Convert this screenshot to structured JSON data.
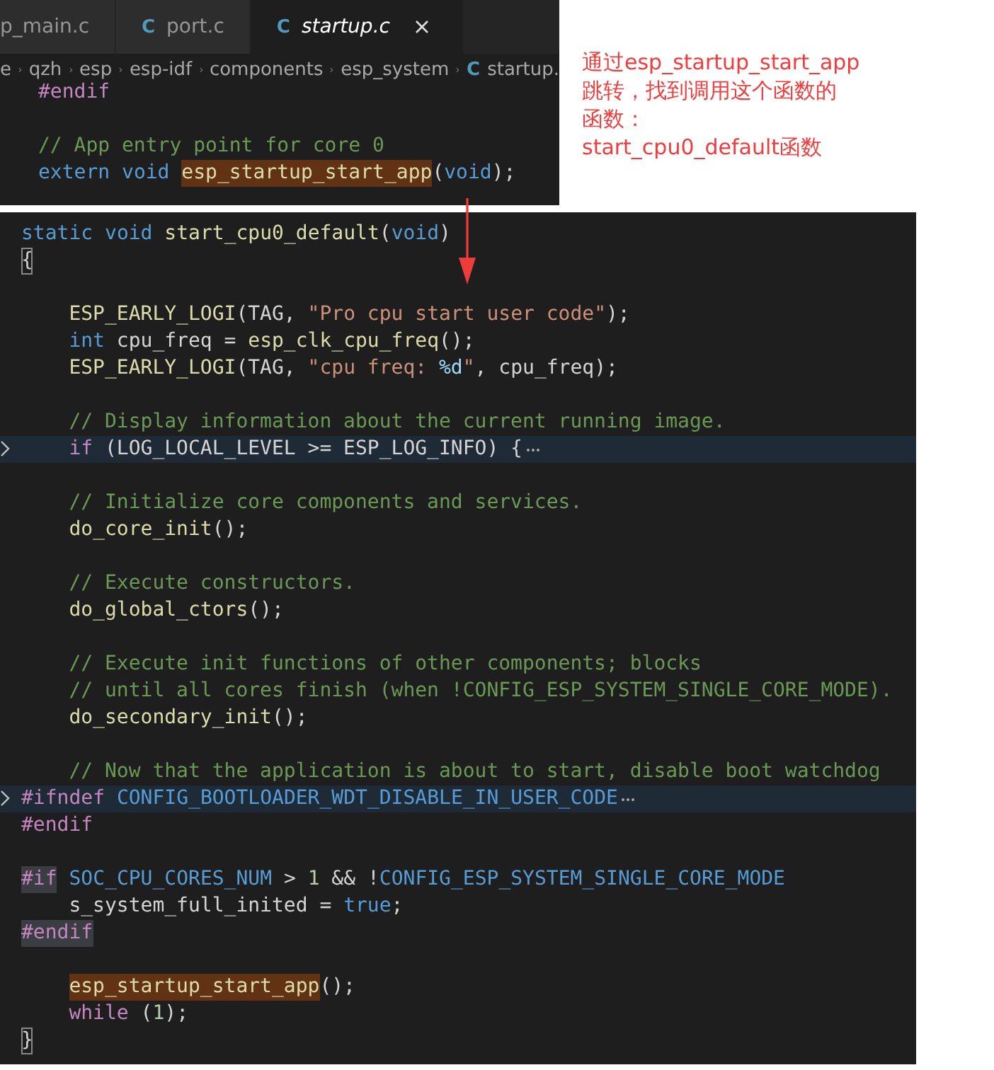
{
  "top_editor": {
    "tabs": [
      {
        "label": "p_main.c",
        "selected": false
      },
      {
        "icon": "C",
        "label": "port.c",
        "selected": false
      },
      {
        "icon": "C",
        "label": "startup.c",
        "selected": true
      }
    ],
    "breadcrumb": [
      {
        "label": "e"
      },
      {
        "label": "qzh"
      },
      {
        "label": "esp"
      },
      {
        "label": "esp-idf"
      },
      {
        "label": "components"
      },
      {
        "label": "esp_system"
      },
      {
        "icon": "C",
        "label": "startup."
      }
    ],
    "lines": [
      {
        "kind": "code",
        "tokens": [
          {
            "kind": "pp",
            "text": "#endif"
          }
        ]
      },
      {
        "kind": "blank"
      },
      {
        "kind": "code",
        "tokens": [
          {
            "kind": "cmt",
            "text": "// App entry point for core 0"
          }
        ]
      },
      {
        "kind": "code",
        "tokens": [
          {
            "kind": "kw",
            "text": "extern "
          },
          {
            "kind": "kw",
            "text": "void "
          },
          {
            "kind": "match",
            "text": "esp_startup_start_app"
          },
          {
            "kind": "txt",
            "text": "("
          },
          {
            "kind": "kw",
            "text": "void"
          },
          {
            "kind": "txt",
            "text": ");"
          }
        ]
      }
    ]
  },
  "annotation": [
    "通过esp_startup_start_app",
    "跳转，找到调用这个函数的",
    "函数：",
    "start_cpu0_default函数"
  ],
  "bottom_editor": {
    "lines": [
      {
        "folded": false,
        "indented": false,
        "tokens": [
          {
            "kind": "kw",
            "text": "static "
          },
          {
            "kind": "kw",
            "text": "void "
          },
          {
            "kind": "fn",
            "text": "start_cpu0_default"
          },
          {
            "kind": "txt",
            "text": "("
          },
          {
            "kind": "kw",
            "text": "void"
          },
          {
            "kind": "txt",
            "text": ")"
          }
        ]
      },
      {
        "folded": false,
        "indented": false,
        "tokens": [
          {
            "kind": "bracket",
            "text": "{"
          }
        ]
      },
      {
        "folded": false
      },
      {
        "folded": false,
        "indented": true,
        "tokens": [
          {
            "kind": "fn",
            "text": "ESP_EARLY_LOGI"
          },
          {
            "kind": "txt",
            "text": "(TAG, "
          },
          {
            "kind": "str",
            "text": "\"Pro cpu start user code\""
          },
          {
            "kind": "txt",
            "text": ");"
          }
        ]
      },
      {
        "folded": false,
        "indented": true,
        "tokens": [
          {
            "kind": "kw",
            "text": "int"
          },
          {
            "kind": "txt",
            "text": " cpu_freq = "
          },
          {
            "kind": "fn",
            "text": "esp_clk_cpu_freq"
          },
          {
            "kind": "txt",
            "text": "();"
          }
        ]
      },
      {
        "folded": false,
        "indented": true,
        "tokens": [
          {
            "kind": "fn",
            "text": "ESP_EARLY_LOGI"
          },
          {
            "kind": "txt",
            "text": "(TAG, "
          },
          {
            "kind": "str",
            "text": "\"cpu freq: "
          },
          {
            "kind": "esc",
            "text": "%d"
          },
          {
            "kind": "str",
            "text": "\""
          },
          {
            "kind": "txt",
            "text": ", cpu_freq);"
          }
        ]
      },
      {
        "folded": false
      },
      {
        "folded": false,
        "indented": true,
        "tokens": [
          {
            "kind": "cmt",
            "text": "// Display information about the current running image."
          }
        ]
      },
      {
        "folded": true,
        "indented": true,
        "tokens": [
          {
            "kind": "ctrl",
            "text": "if"
          },
          {
            "kind": "txt",
            "text": " (LOG_LOCAL_LEVEL >= ESP_LOG_INFO) {"
          }
        ]
      },
      {
        "folded": false
      },
      {
        "folded": false,
        "indented": true,
        "tokens": [
          {
            "kind": "cmt",
            "text": "// Initialize core components and services."
          }
        ]
      },
      {
        "folded": false,
        "indented": true,
        "tokens": [
          {
            "kind": "fn",
            "text": "do_core_init"
          },
          {
            "kind": "txt",
            "text": "();"
          }
        ]
      },
      {
        "folded": false
      },
      {
        "folded": false,
        "indented": true,
        "tokens": [
          {
            "kind": "cmt",
            "text": "// Execute constructors."
          }
        ]
      },
      {
        "folded": false,
        "indented": true,
        "tokens": [
          {
            "kind": "fn",
            "text": "do_global_ctors"
          },
          {
            "kind": "txt",
            "text": "();"
          }
        ]
      },
      {
        "folded": false
      },
      {
        "folded": false,
        "indented": true,
        "tokens": [
          {
            "kind": "cmt",
            "text": "// Execute init functions of other components; blocks"
          }
        ]
      },
      {
        "folded": false,
        "indented": true,
        "tokens": [
          {
            "kind": "cmt",
            "text": "// until all cores finish (when !CONFIG_ESP_SYSTEM_SINGLE_CORE_MODE)."
          }
        ]
      },
      {
        "folded": false,
        "indented": true,
        "tokens": [
          {
            "kind": "fn",
            "text": "do_secondary_init"
          },
          {
            "kind": "txt",
            "text": "();"
          }
        ]
      },
      {
        "folded": false
      },
      {
        "folded": false,
        "indented": true,
        "tokens": [
          {
            "kind": "cmt",
            "text": "// Now that the application is about to start, disable boot watchdog"
          }
        ]
      },
      {
        "folded": true,
        "indented": false,
        "tokens": [
          {
            "kind": "pp",
            "text": "#ifndef "
          },
          {
            "kind": "mac",
            "text": "CONFIG_BOOTLOADER_WDT_DISABLE_IN_USER_CODE"
          }
        ]
      },
      {
        "folded": false,
        "indented": false,
        "tokens": [
          {
            "kind": "pp",
            "text": "#endif"
          }
        ]
      },
      {
        "folded": false
      },
      {
        "folded": false,
        "indented": false,
        "tokens": [
          {
            "kind": "ppmatch",
            "text": "#if"
          },
          {
            "kind": "mac",
            "text": " SOC_CPU_CORES_NUM"
          },
          {
            "kind": "txt",
            "text": " > "
          },
          {
            "kind": "num",
            "text": "1"
          },
          {
            "kind": "txt",
            "text": " && !"
          },
          {
            "kind": "mac",
            "text": "CONFIG_ESP_SYSTEM_SINGLE_CORE_MODE"
          }
        ]
      },
      {
        "folded": false,
        "indented": true,
        "tokens": [
          {
            "kind": "txt",
            "text": "s_system_full_inited = "
          },
          {
            "kind": "kw",
            "text": "true"
          },
          {
            "kind": "txt",
            "text": ";"
          }
        ]
      },
      {
        "folded": false,
        "indented": false,
        "tokens": [
          {
            "kind": "ppmatch",
            "text": "#endif"
          }
        ]
      },
      {
        "folded": false
      },
      {
        "folded": false,
        "indented": true,
        "tokens": [
          {
            "kind": "match",
            "text": "esp_startup_start_app"
          },
          {
            "kind": "txt",
            "text": "();"
          }
        ]
      },
      {
        "folded": false,
        "indented": true,
        "tokens": [
          {
            "kind": "ctrl",
            "text": "while"
          },
          {
            "kind": "txt",
            "text": " ("
          },
          {
            "kind": "num",
            "text": "1"
          },
          {
            "kind": "txt",
            "text": ");"
          }
        ]
      },
      {
        "folded": false,
        "indented": false,
        "tokens": [
          {
            "kind": "bracket",
            "text": "}"
          }
        ]
      }
    ]
  }
}
